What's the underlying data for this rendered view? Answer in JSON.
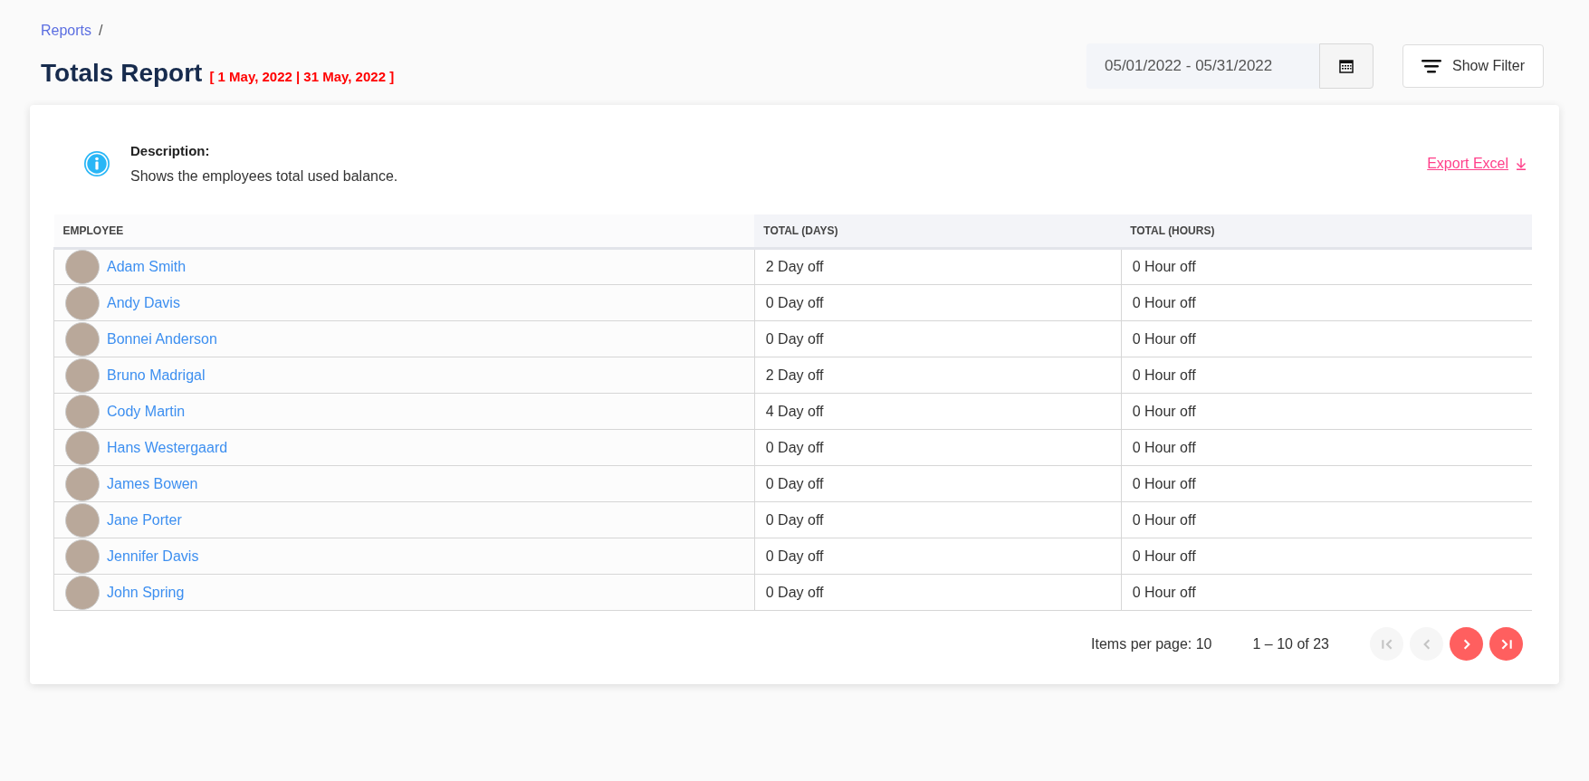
{
  "breadcrumb": {
    "link": "Reports",
    "separator": "/"
  },
  "title": "Totals Report",
  "date_range_label": "[ 1 May, 2022 | 31 May, 2022 ]",
  "date_field": {
    "value": "05/01/2022 - 05/31/2022"
  },
  "filter_button": "Show Filter",
  "description": {
    "heading": "Description:",
    "text": "Shows the employees total used balance."
  },
  "export_link": "Export Excel",
  "table": {
    "columns": [
      "EMPLOYEE",
      "TOTAL (DAYS)",
      "TOTAL (HOURS)"
    ],
    "rows": [
      {
        "employee": "Adam Smith",
        "days": "2 Day off",
        "hours": "0 Hour off"
      },
      {
        "employee": "Andy Davis",
        "days": "0 Day off",
        "hours": "0 Hour off"
      },
      {
        "employee": "Bonnei Anderson",
        "days": "0 Day off",
        "hours": "0 Hour off"
      },
      {
        "employee": "Bruno Madrigal",
        "days": "2 Day off",
        "hours": "0 Hour off"
      },
      {
        "employee": "Cody Martin",
        "days": "4 Day off",
        "hours": "0 Hour off"
      },
      {
        "employee": "Hans Westergaard",
        "days": "0 Day off",
        "hours": "0 Hour off"
      },
      {
        "employee": "James Bowen",
        "days": "0 Day off",
        "hours": "0 Hour off"
      },
      {
        "employee": "Jane Porter",
        "days": "0 Day off",
        "hours": "0 Hour off"
      },
      {
        "employee": "Jennifer Davis",
        "days": "0 Day off",
        "hours": "0 Hour off"
      },
      {
        "employee": "John Spring",
        "days": "0 Day off",
        "hours": "0 Hour off"
      }
    ]
  },
  "pagination": {
    "items_per_page": "Items per page: 10",
    "range": "1 – 10 of 23",
    "buttons": [
      {
        "kind": "first",
        "disabled": true
      },
      {
        "kind": "prev",
        "disabled": true
      },
      {
        "kind": "next",
        "disabled": false
      },
      {
        "kind": "last",
        "disabled": false
      }
    ]
  }
}
